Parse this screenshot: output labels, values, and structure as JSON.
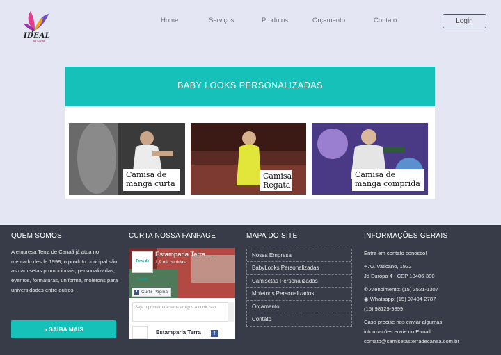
{
  "header": {
    "logo_text": "IDEAL",
    "logo_sub": "by Canaã",
    "nav": [
      "Home",
      "Serviços",
      "Produtos",
      "Orçamento",
      "Contato"
    ],
    "login_label": "Login"
  },
  "panel": {
    "title": "BABY LOOKS PERSONALIZADAS",
    "cards": [
      {
        "caption": "Camisa de manga curta"
      },
      {
        "caption": "Camisa Regata"
      },
      {
        "caption": "Camisa de manga comprida"
      }
    ]
  },
  "footer": {
    "quem_somos": {
      "heading": "QUEM SOMOS",
      "text": "A empresa Terra de Canaã já atua no mercado desde 1998, o produto principal são as camisetas promocionais, personalizadas, eventos, formaturas, uniforme, moletons para universidades entre outros.",
      "button": "» SAIBA MAIS"
    },
    "fanpage": {
      "heading": "CURTA NOSSA FANPAGE",
      "page_name": "Estamparia Terra ...",
      "likes": "1,9 mil curtidas",
      "like_button": "Curtir Página",
      "thumb_label": "Terra de Canaã",
      "comment_placeholder": "Seja o primeiro de seus amigos a curtir isso.",
      "post_name": "Estamparia Terra"
    },
    "mapa": {
      "heading": "MAPA DO SITE",
      "links": [
        "Nossa Empresa",
        "BabyLooks Personalizadas",
        "Camisetas Personalizadas",
        "Moletons Personalizados",
        "Orçamento",
        "Contato"
      ]
    },
    "info": {
      "heading": "INFORMAÇÕES GERAIS",
      "intro": "Entre em contato conosco!",
      "address1": "Av. Vaticano, 1922",
      "address2": "Jd Europa 4 - CEP 18406-380",
      "phone": "Atendimento: (15) 3521-1307",
      "whatsapp": "Whatsapp: (15) 97404-2787",
      "phone2": "(15) 98129-9399",
      "email_text1": "Caso precise nos enviar algumas",
      "email_text2": "informações envie no E-mail:",
      "email": "contato@camisetasterradecanaa.com.br"
    }
  }
}
